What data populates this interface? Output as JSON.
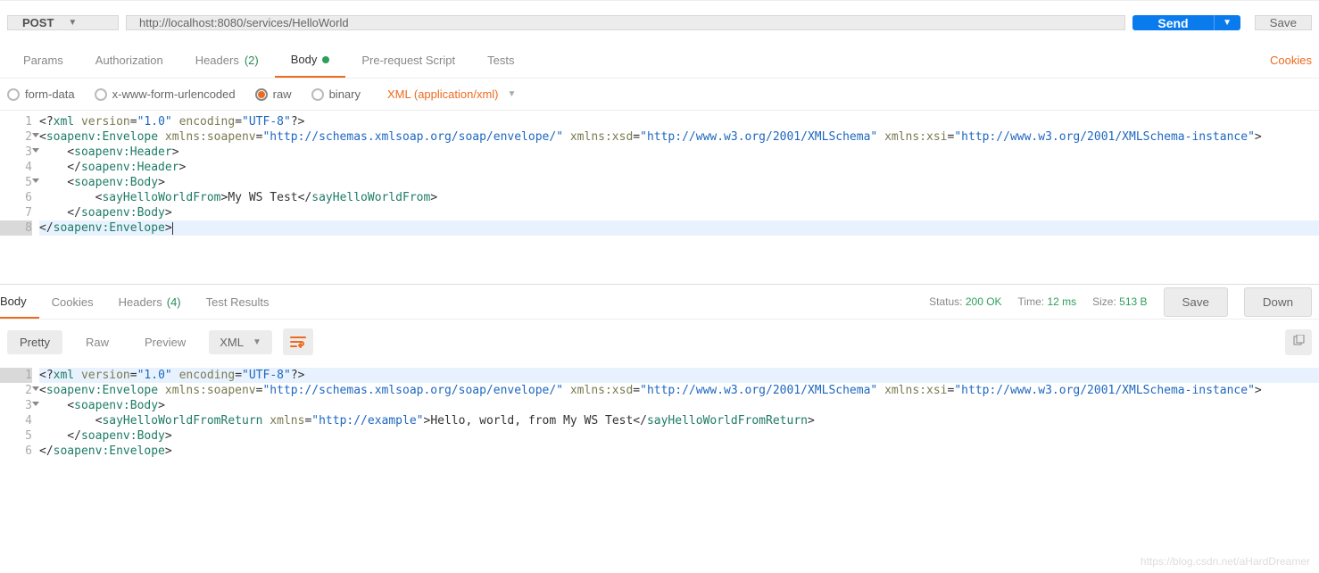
{
  "request": {
    "method": "POST",
    "url": "http://localhost:8080/services/HelloWorld",
    "send_label": "Send",
    "save_label": "Save"
  },
  "tabs": {
    "params": "Params",
    "auth": "Authorization",
    "headers": "Headers",
    "headers_count": "(2)",
    "body": "Body",
    "prerequest": "Pre-request Script",
    "tests": "Tests",
    "cookies_link": "Cookies"
  },
  "body_opts": {
    "formdata": "form-data",
    "urlencoded": "x-www-form-urlencoded",
    "raw": "raw",
    "binary": "binary",
    "content_type": "XML (application/xml)"
  },
  "request_body_lines": [
    {
      "n": "1",
      "fold": false,
      "hl": false,
      "segs": [
        {
          "c": "t-txt",
          "t": "<?"
        },
        {
          "c": "t-tag",
          "t": "xml"
        },
        {
          "c": "t-txt",
          "t": " "
        },
        {
          "c": "t-attr",
          "t": "version"
        },
        {
          "c": "t-txt",
          "t": "="
        },
        {
          "c": "t-str",
          "t": "\"1.0\""
        },
        {
          "c": "t-txt",
          "t": " "
        },
        {
          "c": "t-attr",
          "t": "encoding"
        },
        {
          "c": "t-txt",
          "t": "="
        },
        {
          "c": "t-str",
          "t": "\"UTF-8\""
        },
        {
          "c": "t-txt",
          "t": "?>"
        }
      ]
    },
    {
      "n": "2",
      "fold": true,
      "hl": false,
      "segs": [
        {
          "c": "t-txt",
          "t": "<"
        },
        {
          "c": "t-tag",
          "t": "soapenv:Envelope"
        },
        {
          "c": "t-txt",
          "t": " "
        },
        {
          "c": "t-attr",
          "t": "xmlns:soapenv"
        },
        {
          "c": "t-txt",
          "t": "="
        },
        {
          "c": "t-str",
          "t": "\"http://schemas.xmlsoap.org/soap/envelope/\""
        },
        {
          "c": "t-txt",
          "t": " "
        },
        {
          "c": "t-attr",
          "t": "xmlns:xsd"
        },
        {
          "c": "t-txt",
          "t": "="
        },
        {
          "c": "t-str",
          "t": "\"http://www.w3.org/2001/XMLSchema\""
        },
        {
          "c": "t-txt",
          "t": " "
        },
        {
          "c": "t-attr",
          "t": "xmlns:xsi"
        },
        {
          "c": "t-txt",
          "t": "="
        },
        {
          "c": "t-str",
          "t": "\"http://www.w3.org/2001/XMLSchema-instance\""
        },
        {
          "c": "t-txt",
          "t": ">"
        }
      ]
    },
    {
      "n": "3",
      "fold": true,
      "hl": false,
      "segs": [
        {
          "c": "t-txt",
          "t": "    <"
        },
        {
          "c": "t-tag",
          "t": "soapenv:Header"
        },
        {
          "c": "t-txt",
          "t": ">"
        }
      ]
    },
    {
      "n": "4",
      "fold": false,
      "hl": false,
      "segs": [
        {
          "c": "t-txt",
          "t": "    </"
        },
        {
          "c": "t-tag",
          "t": "soapenv:Header"
        },
        {
          "c": "t-txt",
          "t": ">"
        }
      ]
    },
    {
      "n": "5",
      "fold": true,
      "hl": false,
      "segs": [
        {
          "c": "t-txt",
          "t": "    <"
        },
        {
          "c": "t-tag",
          "t": "soapenv:Body"
        },
        {
          "c": "t-txt",
          "t": ">"
        }
      ]
    },
    {
      "n": "6",
      "fold": false,
      "hl": false,
      "segs": [
        {
          "c": "t-txt",
          "t": "        <"
        },
        {
          "c": "t-tag",
          "t": "sayHelloWorldFrom"
        },
        {
          "c": "t-txt",
          "t": ">My WS Test</"
        },
        {
          "c": "t-tag",
          "t": "sayHelloWorldFrom"
        },
        {
          "c": "t-txt",
          "t": ">"
        }
      ]
    },
    {
      "n": "7",
      "fold": false,
      "hl": false,
      "segs": [
        {
          "c": "t-txt",
          "t": "    </"
        },
        {
          "c": "t-tag",
          "t": "soapenv:Body"
        },
        {
          "c": "t-txt",
          "t": ">"
        }
      ]
    },
    {
      "n": "8",
      "fold": false,
      "hl": true,
      "cursor": true,
      "segs": [
        {
          "c": "t-txt",
          "t": "</"
        },
        {
          "c": "t-tag",
          "t": "soapenv:Envelope"
        },
        {
          "c": "t-txt",
          "t": ">"
        }
      ]
    }
  ],
  "response": {
    "tabs": {
      "body": "Body",
      "cookies": "Cookies",
      "headers": "Headers",
      "headers_count": "(4)",
      "test_results": "Test Results"
    },
    "status_label": "Status:",
    "status_value": "200 OK",
    "time_label": "Time:",
    "time_value": "12 ms",
    "size_label": "Size:",
    "size_value": "513 B",
    "save_label": "Save",
    "download_label": "Down",
    "pretty": "Pretty",
    "raw": "Raw",
    "preview": "Preview",
    "format": "XML"
  },
  "response_body_lines": [
    {
      "n": "1",
      "fold": false,
      "hl": true,
      "segs": [
        {
          "c": "t-txt",
          "t": "<?"
        },
        {
          "c": "t-tag",
          "t": "xml"
        },
        {
          "c": "t-txt",
          "t": " "
        },
        {
          "c": "t-attr",
          "t": "version"
        },
        {
          "c": "t-txt",
          "t": "="
        },
        {
          "c": "t-str",
          "t": "\"1.0\""
        },
        {
          "c": "t-txt",
          "t": " "
        },
        {
          "c": "t-attr",
          "t": "encoding"
        },
        {
          "c": "t-txt",
          "t": "="
        },
        {
          "c": "t-str",
          "t": "\"UTF-8\""
        },
        {
          "c": "t-txt",
          "t": "?>"
        }
      ]
    },
    {
      "n": "2",
      "fold": true,
      "hl": false,
      "segs": [
        {
          "c": "t-txt",
          "t": "<"
        },
        {
          "c": "t-tag",
          "t": "soapenv:Envelope"
        },
        {
          "c": "t-txt",
          "t": " "
        },
        {
          "c": "t-attr",
          "t": "xmlns:soapenv"
        },
        {
          "c": "t-txt",
          "t": "="
        },
        {
          "c": "t-str",
          "t": "\"http://schemas.xmlsoap.org/soap/envelope/\""
        },
        {
          "c": "t-txt",
          "t": " "
        },
        {
          "c": "t-attr",
          "t": "xmlns:xsd"
        },
        {
          "c": "t-txt",
          "t": "="
        },
        {
          "c": "t-str",
          "t": "\"http://www.w3.org/2001/XMLSchema\""
        },
        {
          "c": "t-txt",
          "t": " "
        },
        {
          "c": "t-attr",
          "t": "xmlns:xsi"
        },
        {
          "c": "t-txt",
          "t": "="
        },
        {
          "c": "t-str",
          "t": "\"http://www.w3.org/2001/XMLSchema-instance\""
        },
        {
          "c": "t-txt",
          "t": ">"
        }
      ]
    },
    {
      "n": "3",
      "fold": true,
      "hl": false,
      "segs": [
        {
          "c": "t-txt",
          "t": "    <"
        },
        {
          "c": "t-tag",
          "t": "soapenv:Body"
        },
        {
          "c": "t-txt",
          "t": ">"
        }
      ]
    },
    {
      "n": "4",
      "fold": false,
      "hl": false,
      "segs": [
        {
          "c": "t-txt",
          "t": "        <"
        },
        {
          "c": "t-tag",
          "t": "sayHelloWorldFromReturn"
        },
        {
          "c": "t-txt",
          "t": " "
        },
        {
          "c": "t-attr",
          "t": "xmlns"
        },
        {
          "c": "t-txt",
          "t": "="
        },
        {
          "c": "t-str",
          "t": "\"http://example\""
        },
        {
          "c": "t-txt",
          "t": ">Hello, world, from My WS Test</"
        },
        {
          "c": "t-tag",
          "t": "sayHelloWorldFromReturn"
        },
        {
          "c": "t-txt",
          "t": ">"
        }
      ]
    },
    {
      "n": "5",
      "fold": false,
      "hl": false,
      "segs": [
        {
          "c": "t-txt",
          "t": "    </"
        },
        {
          "c": "t-tag",
          "t": "soapenv:Body"
        },
        {
          "c": "t-txt",
          "t": ">"
        }
      ]
    },
    {
      "n": "6",
      "fold": false,
      "hl": false,
      "segs": [
        {
          "c": "t-txt",
          "t": "</"
        },
        {
          "c": "t-tag",
          "t": "soapenv:Envelope"
        },
        {
          "c": "t-txt",
          "t": ">"
        }
      ]
    }
  ],
  "watermark": "https://blog.csdn.net/aHardDreamer"
}
